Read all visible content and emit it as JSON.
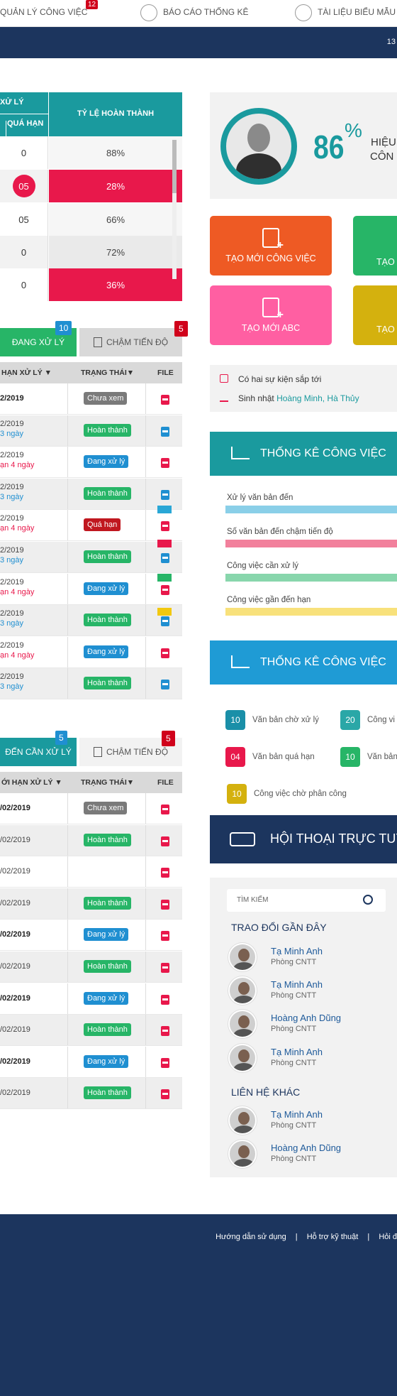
{
  "topnav": {
    "item1": "QUẢN LÝ CÔNG VIỆC",
    "item1_badge": "12",
    "item2": "BÁO CÁO THỐNG KÊ",
    "item3": "TÀI LIỆU BIỂU MẪU"
  },
  "banner": {
    "right_text": "13"
  },
  "progress_table": {
    "header_group": "XỬ LÝ",
    "col_overdue": "QUÁ HẠN",
    "col_rate": "TỶ LỆ HOÀN THÀNH",
    "rows": [
      {
        "overdue": "0",
        "rate": "88%"
      },
      {
        "overdue": "05",
        "rate": "28%"
      },
      {
        "overdue": "05",
        "rate": "66%"
      },
      {
        "overdue": "0",
        "rate": "72%"
      },
      {
        "overdue": "0",
        "rate": "36%"
      }
    ]
  },
  "list1": {
    "tab_active": "ĐANG XỬ LÝ",
    "tab_active_badge": "10",
    "tab_other": "CHẬM TIẾN ĐỘ",
    "tab_other_badge": "5",
    "col_deadline": "HẠN XỬ LÝ",
    "col_status": "TRẠNG THÁI",
    "col_file": "FILE",
    "rows": [
      {
        "date": "2/2019",
        "note": "",
        "status": "Chưa xem"
      },
      {
        "date": "2/2019",
        "note": "3 ngày",
        "status": "Hoàn thành"
      },
      {
        "date": "2/2019",
        "note": "ạn 4 ngày",
        "status": "Đang xử lý"
      },
      {
        "date": "2/2019",
        "note": "3 ngày",
        "status": "Hoàn thành"
      },
      {
        "date": "2/2019",
        "note": "ạn 4 ngày",
        "status": "Quá hạn"
      },
      {
        "date": "2/2019",
        "note": "3 ngày",
        "status": "Hoàn thành"
      },
      {
        "date": "2/2019",
        "note": "ạn 4 ngày",
        "status": "Đang xử lý"
      },
      {
        "date": "2/2019",
        "note": "3 ngày",
        "status": "Hoàn thành"
      },
      {
        "date": "2/2019",
        "note": "ạn 4 ngày",
        "status": "Đang xử lý"
      },
      {
        "date": "2/2019",
        "note": "3 ngày",
        "status": "Hoàn thành"
      }
    ]
  },
  "list2": {
    "tab_active": "ĐẾN CẦN XỬ LÝ",
    "tab_active_badge": "5",
    "tab_other": "CHẬM TIẾN ĐỘ",
    "tab_other_badge": "5",
    "col_deadline": "ỚI HẠN XỬ LÝ",
    "col_status": "TRẠNG THÁI",
    "col_file": "FILE",
    "rows": [
      {
        "date": "/02/2019",
        "status": "Chưa xem"
      },
      {
        "date": "/02/2019",
        "status": "Hoàn thành"
      },
      {
        "date": "/02/2019",
        "status": ""
      },
      {
        "date": "/02/2019",
        "status": "Hoàn thành"
      },
      {
        "date": "/02/2019",
        "status": "Đang xử lý"
      },
      {
        "date": "/02/2019",
        "status": "Hoàn thành"
      },
      {
        "date": "/02/2019",
        "status": "Đang xử lý"
      },
      {
        "date": "/02/2019",
        "status": "Hoàn thành"
      },
      {
        "date": "/02/2019",
        "status": "Đang xử lý"
      },
      {
        "date": "/02/2019",
        "status": "Hoàn thành"
      }
    ]
  },
  "profile": {
    "percent": "86",
    "percent_sign": "%",
    "label1": "HIỆU",
    "label2": "CÔN"
  },
  "actions": {
    "create_task": "TẠO MỚI CÔNG VIỆC",
    "create_abc": "TẠO MỚI ABC",
    "create_right1": "TẠO",
    "create_right2": "TẠO"
  },
  "events": {
    "line1": "Có hai sự kiện sắp tới",
    "birthday_prefix": "Sinh nhật",
    "birthday_names": "Hoàng Minh, Hà Thủy"
  },
  "stats1": {
    "title": "THỐNG KÊ CÔNG VIỆC",
    "bars": [
      {
        "label": "Xử lý văn bản đến",
        "color": "#2aa7d6"
      },
      {
        "label": "Số văn bản đến chậm tiến độ",
        "color": "#e8184b"
      },
      {
        "label": "Công việc cần xử lý",
        "color": "#27b567"
      },
      {
        "label": "Công việc gần đến hạn",
        "color": "#f2c80f"
      }
    ]
  },
  "stats2": {
    "title": "THỐNG KÊ CÔNG VIỆC",
    "items": [
      {
        "count": "10",
        "label": "Văn bản chờ xử lý"
      },
      {
        "count": "20",
        "label": "Công vi"
      },
      {
        "count": "04",
        "label": "Văn bản quá hạn"
      },
      {
        "count": "10",
        "label": "Văn bản"
      },
      {
        "count": "10",
        "label": "Công việc chờ phân công"
      }
    ]
  },
  "chat": {
    "title": "HỘI THOẠI TRỰC TUYẾ",
    "search_placeholder": "TÌM KIẾM",
    "recent_title": "TRAO ĐỔI GẦN ĐÂY",
    "other_title": "LIÊN HỆ KHÁC",
    "recent": [
      {
        "name": "Tạ Minh Anh",
        "dept": "Phòng CNTT"
      },
      {
        "name": "Tạ Minh Anh",
        "dept": "Phòng CNTT"
      },
      {
        "name": "Hoàng Anh Dũng",
        "dept": "Phòng CNTT"
      },
      {
        "name": "Tạ Minh Anh",
        "dept": "Phòng CNTT"
      }
    ],
    "others": [
      {
        "name": "Tạ Minh Anh",
        "dept": "Phòng CNTT"
      },
      {
        "name": "Hoàng Anh Dũng",
        "dept": "Phòng CNTT"
      }
    ]
  },
  "footer": {
    "link1": "Hướng dẫn sử dụng",
    "link2": "Hỗ trợ kỹ thuật",
    "link3": "Hỏi đ",
    "sep": "|"
  },
  "colors": {
    "navy": "#1c355e",
    "teal": "#1a9a9e",
    "red": "#e8184b",
    "green": "#27b567",
    "blue": "#1f8fd1",
    "gray": "#7a7a7a"
  }
}
